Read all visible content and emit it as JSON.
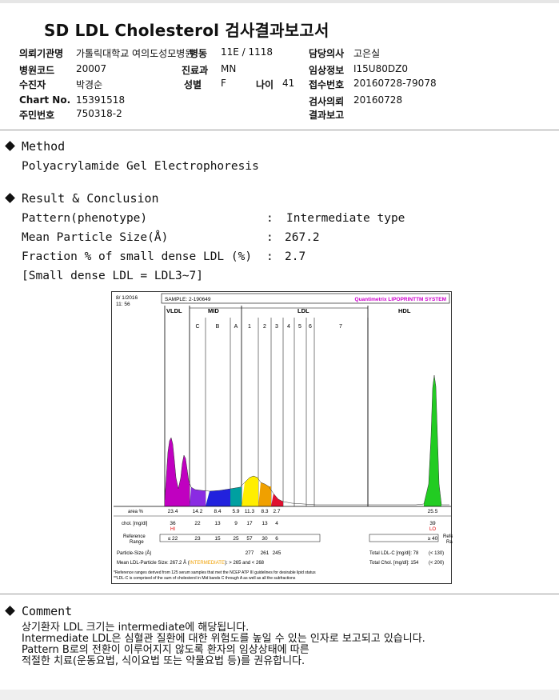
{
  "title": "SD LDL Cholesterol 검사결과보고서",
  "header": {
    "inst_label": "의뢰기관명",
    "inst_value": "가톨릭대학교 여의도성모병원",
    "ward_label": "병동",
    "ward_value": "11E / 1118",
    "doctor_label": "담당의사",
    "doctor_value": "고은실",
    "hosp_code_label": "병원코드",
    "hosp_code_value": "20007",
    "dept_label": "진료과",
    "dept_value": "MN",
    "clinical_label": "임상정보",
    "clinical_value": "I15U80DZ0",
    "patient_label": "수진자",
    "patient_value": "박경순",
    "sex_label": "성별",
    "sex_value": "F",
    "age_label": "나이",
    "age_value": "41",
    "receipt_label": "접수번호",
    "receipt_value": "20160728-79078",
    "chart_label": "Chart No.",
    "chart_value": "15391518",
    "request_label": "검사의뢰",
    "request_value": "20160728",
    "rrn_label": "주민번호",
    "rrn_value": "750318-2",
    "report_label": "결과보고",
    "report_value": ""
  },
  "method": {
    "heading": "Method",
    "text": "Polyacrylamide Gel Electrophoresis"
  },
  "result": {
    "heading": "Result & Conclusion",
    "rows": [
      {
        "label": "Pattern(phenotype)",
        "colon": ":",
        "value": "Intermediate type"
      },
      {
        "label": "Mean Particle Size(Å)",
        "colon": ":",
        "value": "267.2"
      },
      {
        "label": "Fraction % of small dense LDL (%)",
        "colon": ":",
        "value": "2.7"
      }
    ],
    "note": "[Small dense LDL = LDL3~7]"
  },
  "chart": {
    "date": "8/ 1/2016",
    "time": "11: 56",
    "sample": "SAMPLE:  2-190649",
    "brand": "Quantimetrix LIPOPRINT",
    "brand_tm": "TM",
    "brand_suffix": " SYSTEM",
    "groups": {
      "vldl": "VLDL",
      "mid": "MID",
      "ldl": "LDL",
      "hdl": "HDL"
    },
    "bands": [
      "C",
      "B",
      "A",
      "1",
      "2",
      "3",
      "4",
      "5",
      "6",
      "7"
    ],
    "row_labels": {
      "area": "area %",
      "chol": "chol. [mg/dl]",
      "ref": "Reference Range",
      "size": "Particle-Size (Å)",
      "mean": "Mean LDL-Particle Size:"
    },
    "area": [
      "23.4",
      "14.2",
      "8.4",
      "5.9",
      "11.3",
      "8.3",
      "2.7",
      "25.5"
    ],
    "chol": [
      "36",
      "22",
      "13",
      "9",
      "17",
      "13",
      "4",
      "39"
    ],
    "chol_flags": [
      "HI",
      "LO"
    ],
    "ref": [
      "≤ 22",
      "23",
      "15",
      "25",
      "57",
      "30",
      "6",
      "≥ 40"
    ],
    "sizes": [
      "277",
      "261",
      "245"
    ],
    "mean_value": "267.2 Å",
    "mean_type": "INTERMEDIATE",
    "mean_ranges": "> 265 and < 268",
    "total_ldl_label": "Total LDL-C [mg/dl]:",
    "total_ldl_value": "78",
    "total_ldl_ref": "(< 130)",
    "total_chol_label": "Total Chol. [mg/dl]:",
    "total_chol_value": "154",
    "total_chol_ref": "(< 200)",
    "right_ref_label": "Reference Range",
    "footnote1": "*Reference ranges derived from 125 serum samples that met the NCEP ATP III guidelines for desirable lipid status",
    "footnote2": "**LDL-C is comprised of the sum of cholesterol in Mid bands C through A as well as all the subfractions",
    "colors": {
      "vldl": "#c000c0",
      "c": "#8a2be2",
      "b": "#2222dd",
      "a": "#00a0a0",
      "l1": "#ffee00",
      "l2": "#f0a000",
      "l3": "#e01030",
      "hdl": "#22cc22",
      "brand": "#cc00cc"
    }
  },
  "comment": {
    "heading": "Comment",
    "lines": [
      "상기환자 LDL 크기는 intermediate에 해당됩니다.",
      "Intermediate LDL은 심혈관 질환에 대한 위험도를 높일 수 있는 인자로 보고되고 있습니다.",
      "Pattern B로의 전환이 이루어지지 않도록 환자의 임상상태에 따른",
      "적절한 치료(운동요법, 식이요법 또는 약물요법 등)를 권유합니다."
    ]
  }
}
